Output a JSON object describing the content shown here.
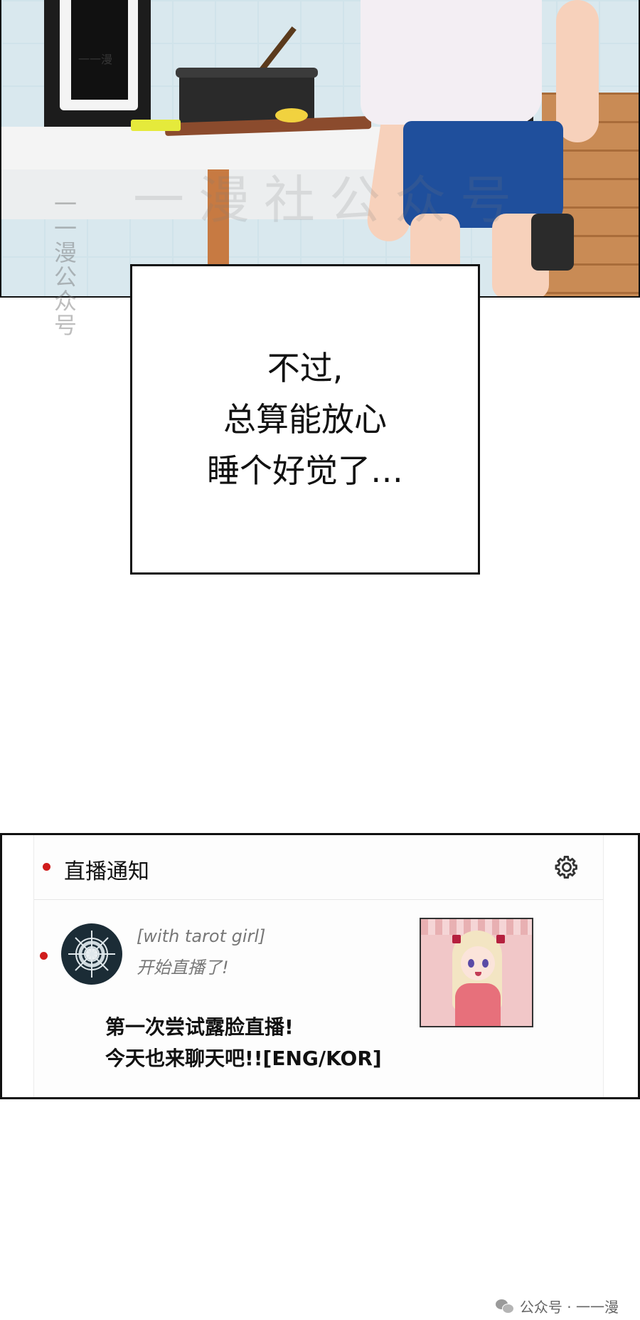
{
  "top_panel": {
    "watermark_big": "一漫社公众号",
    "watermark_small": "一一漫"
  },
  "side_watermark": "一一漫公众号",
  "speech": {
    "lines": [
      "不过,",
      "总算能放心",
      "睡个好觉了…"
    ]
  },
  "notification": {
    "header_title": "直播通知",
    "settings_icon": "gear-icon",
    "user_name": "[with tarot girl]",
    "status": "开始直播了!",
    "stream_title_lines": [
      "第一次尝试露脸直播!",
      "今天也来聊天吧!![ENG/KOR]"
    ],
    "accent_color": "#d01c1c"
  },
  "footer": {
    "icon": "wechat-icon",
    "text": "公众号 · 一一漫"
  }
}
